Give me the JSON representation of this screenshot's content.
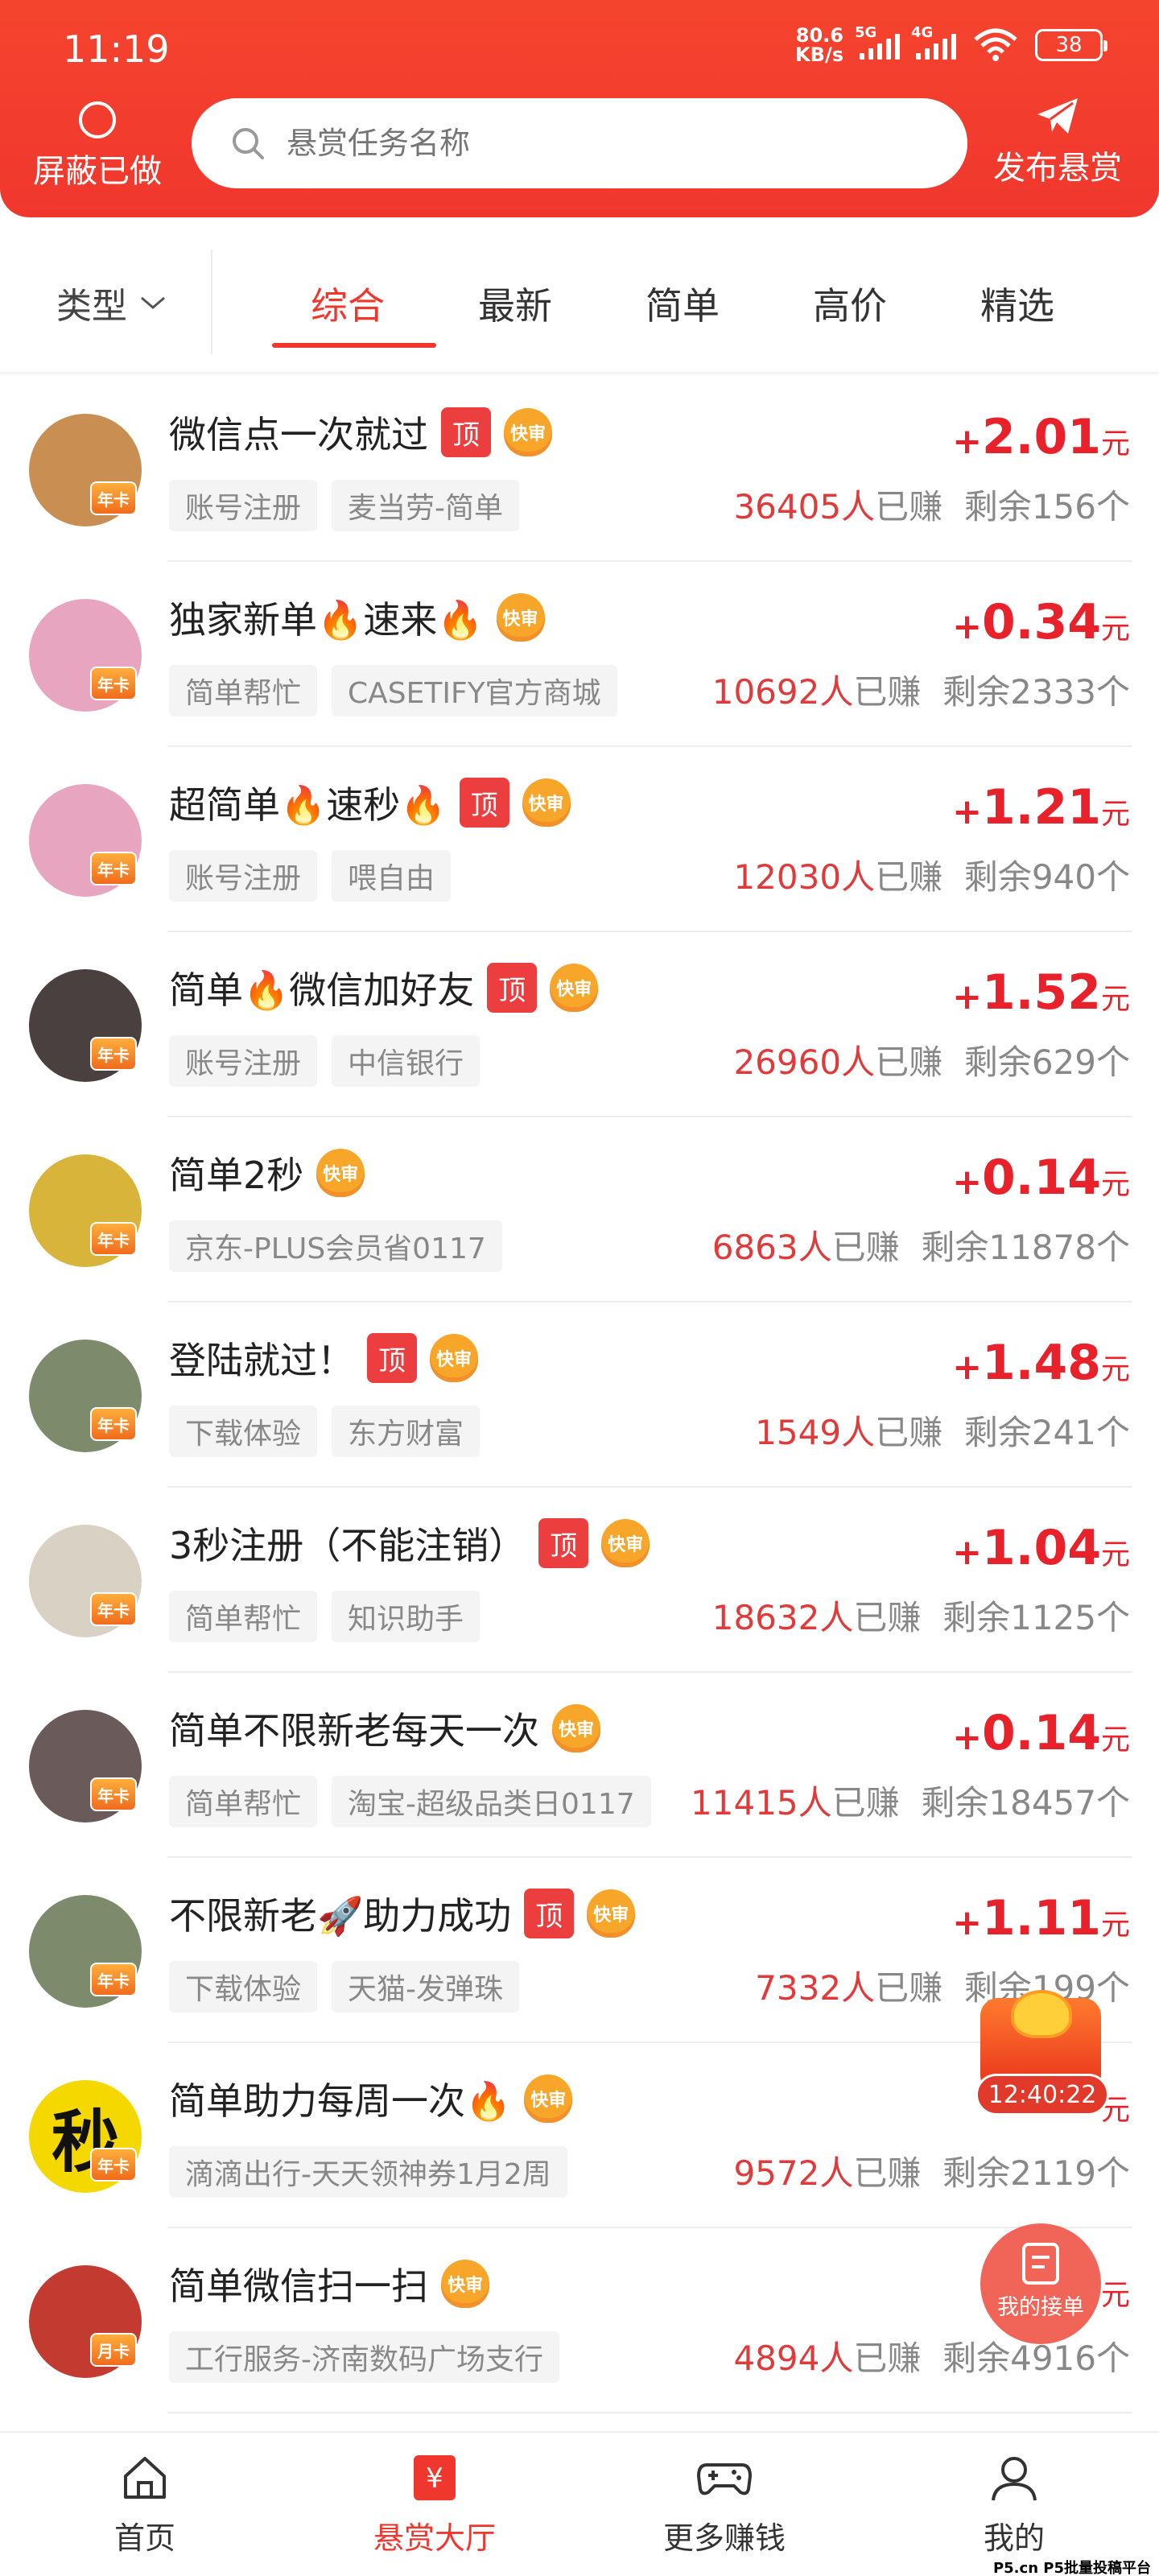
{
  "status_bar": {
    "time": "11:19",
    "net_speed_value": "80.6",
    "net_speed_unit": "KB/s",
    "signal1": "5G",
    "signal2": "4G",
    "battery": "38"
  },
  "header": {
    "hide_done_label": "屏蔽已做",
    "search_placeholder": "悬赏任务名称",
    "publish_label": "发布悬赏"
  },
  "filter": {
    "type_label": "类型",
    "tabs": [
      {
        "label": "综合",
        "active": true
      },
      {
        "label": "最新",
        "active": false
      },
      {
        "label": "简单",
        "active": false
      },
      {
        "label": "高价",
        "active": false
      },
      {
        "label": "精选",
        "active": false
      }
    ]
  },
  "labels": {
    "top": "顶",
    "fast": "快审",
    "year_card": "年卡",
    "month_card": "月卡",
    "earned_suffix": "人已赚",
    "remain_prefix": "剩余",
    "remain_suffix": "个",
    "plus": "+",
    "unit": "元"
  },
  "tasks": [
    {
      "title": "微信点一次就过",
      "top": true,
      "fast": true,
      "chips": [
        "账号注册",
        "麦当劳-简单"
      ],
      "price": "2.01",
      "earned": "36405",
      "remaining": "156",
      "card": "年卡",
      "avatar_color": "#c98f52"
    },
    {
      "title": "独家新单🔥速来🔥",
      "top": false,
      "fast": true,
      "chips": [
        "简单帮忙",
        "CASETIFY官方商城"
      ],
      "price": "0.34",
      "earned": "10692",
      "remaining": "2333",
      "card": "年卡",
      "avatar_color": "#e7a5c0"
    },
    {
      "title": "超简单🔥速秒🔥",
      "top": true,
      "fast": true,
      "chips": [
        "账号注册",
        "喂自由"
      ],
      "price": "1.21",
      "earned": "12030",
      "remaining": "940",
      "card": "年卡",
      "avatar_color": "#e7a5c0"
    },
    {
      "title": "简单🔥微信加好友",
      "top": true,
      "fast": true,
      "chips": [
        "账号注册",
        "中信银行"
      ],
      "price": "1.52",
      "earned": "26960",
      "remaining": "629",
      "card": "年卡",
      "avatar_color": "#4a4040"
    },
    {
      "title": "简单2秒",
      "top": false,
      "fast": true,
      "chips": [
        "京东-PLUS会员省0117"
      ],
      "price": "0.14",
      "earned": "6863",
      "remaining": "11878",
      "card": "年卡",
      "avatar_color": "#d8b43a"
    },
    {
      "title": "登陆就过！",
      "top": true,
      "fast": true,
      "chips": [
        "下载体验",
        "东方财富"
      ],
      "price": "1.48",
      "earned": "1549",
      "remaining": "241",
      "card": "年卡",
      "avatar_color": "#7d8a6c"
    },
    {
      "title": "3秒注册（不能注销）",
      "top": true,
      "fast": true,
      "chips": [
        "简单帮忙",
        "知识助手"
      ],
      "price": "1.04",
      "earned": "18632",
      "remaining": "1125",
      "card": "年卡",
      "avatar_color": "#d9d2c4"
    },
    {
      "title": "简单不限新老每天一次",
      "top": false,
      "fast": true,
      "chips": [
        "简单帮忙",
        "淘宝-超级品类日0117"
      ],
      "price": "0.14",
      "earned": "11415",
      "remaining": "18457",
      "card": "年卡",
      "avatar_color": "#6b5a5a"
    },
    {
      "title": "不限新老🚀助力成功",
      "top": true,
      "fast": true,
      "chips": [
        "下载体验",
        "天猫-发弹珠"
      ],
      "price": "1.11",
      "earned": "7332",
      "remaining": "199",
      "card": "年卡",
      "avatar_color": "#7d8a6c"
    },
    {
      "title": "简单助力每周一次🔥",
      "top": false,
      "fast": true,
      "chips": [
        "滴滴出行-天天领神券1月2周"
      ],
      "price": "",
      "earned": "9572",
      "remaining": "2119",
      "card": "年卡",
      "avatar_color": "#f5d800",
      "avatar_text": "秒"
    },
    {
      "title": "简单微信扫一扫",
      "top": false,
      "fast": true,
      "chips": [
        "工行服务-济南数码广场支行"
      ],
      "price": "",
      "earned": "4894",
      "remaining": "4916",
      "card": "月卡",
      "avatar_color": "#c23a30"
    }
  ],
  "floating": {
    "countdown": "12:40:22",
    "my_orders_label": "我的接单"
  },
  "bottom_nav": [
    {
      "label": "首页",
      "icon": "home-icon",
      "active": false
    },
    {
      "label": "悬赏大厅",
      "icon": "reward-hall-icon",
      "active": true
    },
    {
      "label": "更多赚钱",
      "icon": "gamepad-icon",
      "active": false
    },
    {
      "label": "我的",
      "icon": "user-icon",
      "active": false
    }
  ],
  "watermark": "P5.cn P5批量投稿平台",
  "colors": {
    "brand_red": "#f0372e",
    "price_red": "#e8212a",
    "fast_orange": "#f8a62a"
  }
}
